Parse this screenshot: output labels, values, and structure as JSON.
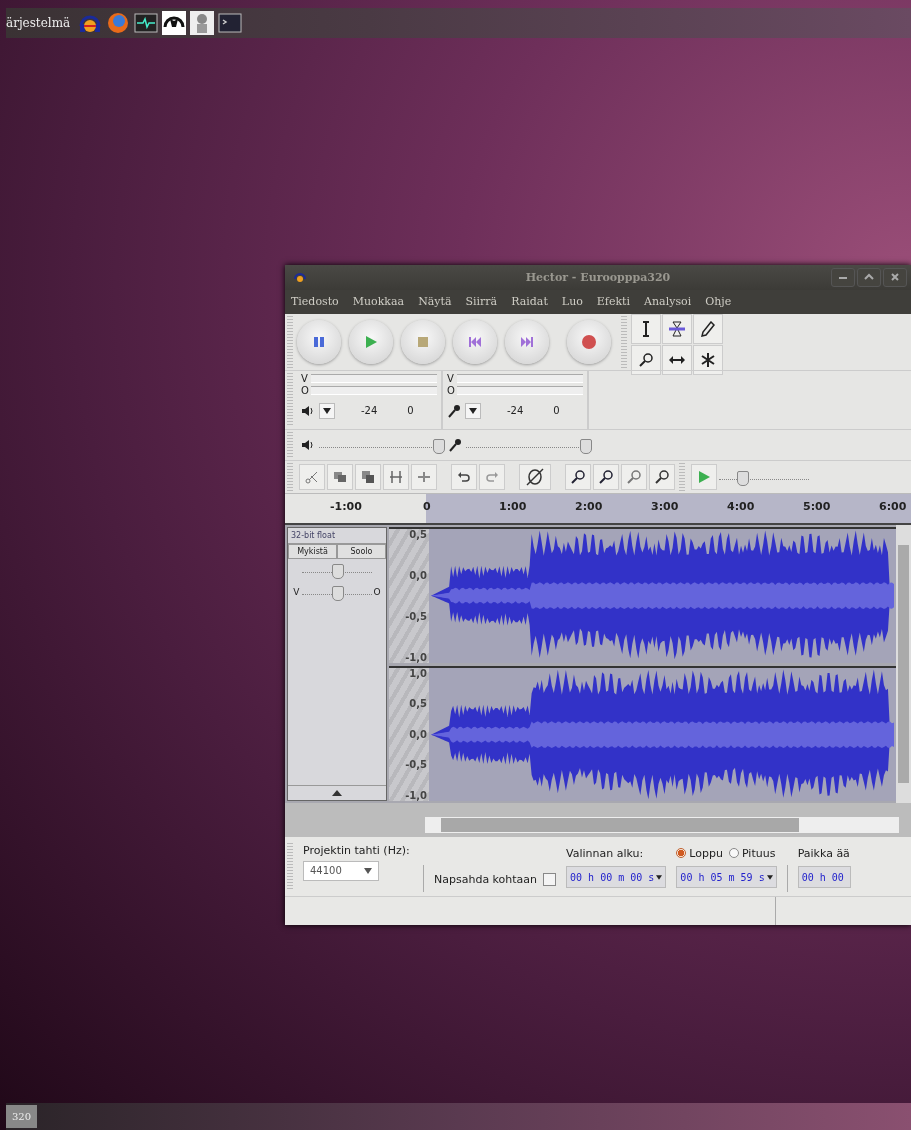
{
  "top_panel": {
    "menu": "ärjestelmä"
  },
  "window": {
    "title": "Hector - Euroopppa320",
    "menu": [
      "Tiedosto",
      "Muokkaa",
      "Näytä",
      "Siirrä",
      "Raidat",
      "Luo",
      "Efekti",
      "Analysoi",
      "Ohje"
    ],
    "meters": [
      {
        "kind": "output",
        "channels": [
          "V",
          "O"
        ],
        "ticks": [
          "-24",
          "0"
        ]
      },
      {
        "kind": "input",
        "channels": [
          "V",
          "O"
        ],
        "ticks": [
          "-24",
          "0"
        ]
      }
    ],
    "mixer": [
      {
        "kind": "output",
        "level": 0.95
      },
      {
        "kind": "input",
        "level": 0.95
      }
    ],
    "play_speed": {
      "level": 0.25
    },
    "ruler": [
      "-1:00",
      "0",
      "1:00",
      "2:00",
      "3:00",
      "4:00",
      "5:00",
      "6:00"
    ],
    "track": {
      "format": "32-bit float",
      "buttons": [
        "Mykistä",
        "Soolo"
      ],
      "gain": {
        "level": 0.5
      },
      "pan": {
        "left": "V",
        "right": "O",
        "level": 0.5
      },
      "channels": [
        {
          "scale": [
            "0,5",
            "0,0",
            "-0,5",
            "-1,0"
          ]
        },
        {
          "scale": [
            "1,0",
            "0,5",
            "0,0",
            "-0,5",
            "-1,0"
          ]
        }
      ]
    },
    "selection_bar": {
      "rate_label": "Projektin tahti (Hz):",
      "rate": "44100",
      "snap": {
        "label": "Napsahda kohtaan",
        "checked": false
      },
      "start_label": "Valinnan alku:",
      "modes": [
        {
          "label": "Loppu",
          "selected": true
        },
        {
          "label": "Pituus",
          "selected": false
        }
      ],
      "position_label": "Paikka ää",
      "times": [
        "00 h 00 m 00 s",
        "00 h 05 m 59 s",
        "00 h 00"
      ]
    }
  },
  "taskbar": {
    "button": "320"
  }
}
